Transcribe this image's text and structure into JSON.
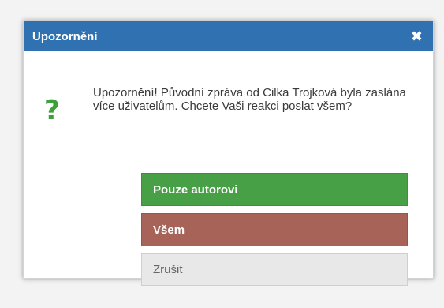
{
  "dialog": {
    "title": "Upozornění",
    "close_glyph": "✖",
    "icon": "question-icon",
    "icon_glyph": "?",
    "message": "Upozornění! Původní zpráva od Cilka Trojková byla zaslána více uživatelům. Chcete Vaši reakci poslat všem?",
    "buttons": {
      "author": "Pouze autorovi",
      "all": "Všem",
      "cancel": "Zrušit"
    },
    "colors": {
      "titlebar": "#2f71b1",
      "author_button": "#48a046",
      "all_button": "#a86359",
      "cancel_button": "#e8e8e8",
      "icon": "#3da13a"
    }
  }
}
